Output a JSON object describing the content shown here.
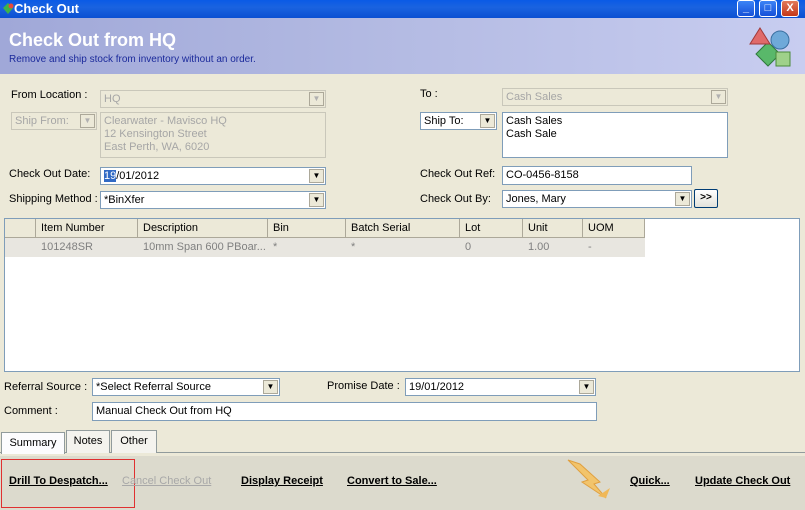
{
  "window": {
    "title": "Check Out",
    "min": "_",
    "max": "□",
    "close": "X"
  },
  "header": {
    "title": "Check Out from HQ",
    "subtitle": "Remove and ship stock from inventory without an order."
  },
  "form": {
    "from_location_label": "From Location :",
    "from_location_value": "HQ",
    "ship_from_label": "Ship From:",
    "from_address": [
      "Clearwater - Mavisco HQ",
      "12 Kensington Street",
      "East Perth, WA, 6020"
    ],
    "to_label": "To :",
    "to_value": "Cash Sales",
    "ship_to_label": "Ship To:",
    "to_address": [
      "Cash Sales",
      "Cash Sale"
    ],
    "check_out_date_label": "Check Out Date:",
    "check_out_date_sel": "19",
    "check_out_date_rest": "/01/2012",
    "shipping_method_label": "Shipping Method :",
    "shipping_method_value": "*BinXfer",
    "check_out_ref_label": "Check Out Ref:",
    "check_out_ref_value": "CO-0456-8158",
    "check_out_by_label": "Check Out By:",
    "check_out_by_value": "Jones, Mary",
    "more_button": ">>"
  },
  "grid": {
    "columns": [
      "",
      "Item Number",
      "Description",
      "Bin",
      "Batch Serial",
      "Lot",
      "Unit",
      "UOM"
    ],
    "rows": [
      [
        "",
        "101248SR",
        "10mm Span 600 PBoar...",
        "*",
        "*",
        "0",
        "1.00",
        "-"
      ]
    ]
  },
  "lower": {
    "referral_label": "Referral Source :",
    "referral_value": "*Select Referral Source",
    "promise_label": "Promise Date :",
    "promise_value": "19/01/2012",
    "comment_label": "Comment :",
    "comment_value": "Manual Check Out from HQ"
  },
  "tabs": [
    "Summary",
    "Notes",
    "Other"
  ],
  "actions": {
    "drill": "Drill To Despatch...",
    "cancel": "Cancel Check Out",
    "receipt": "Display Receipt",
    "convert": "Convert to Sale...",
    "quick": "Quick...",
    "update": "Update Check Out"
  }
}
